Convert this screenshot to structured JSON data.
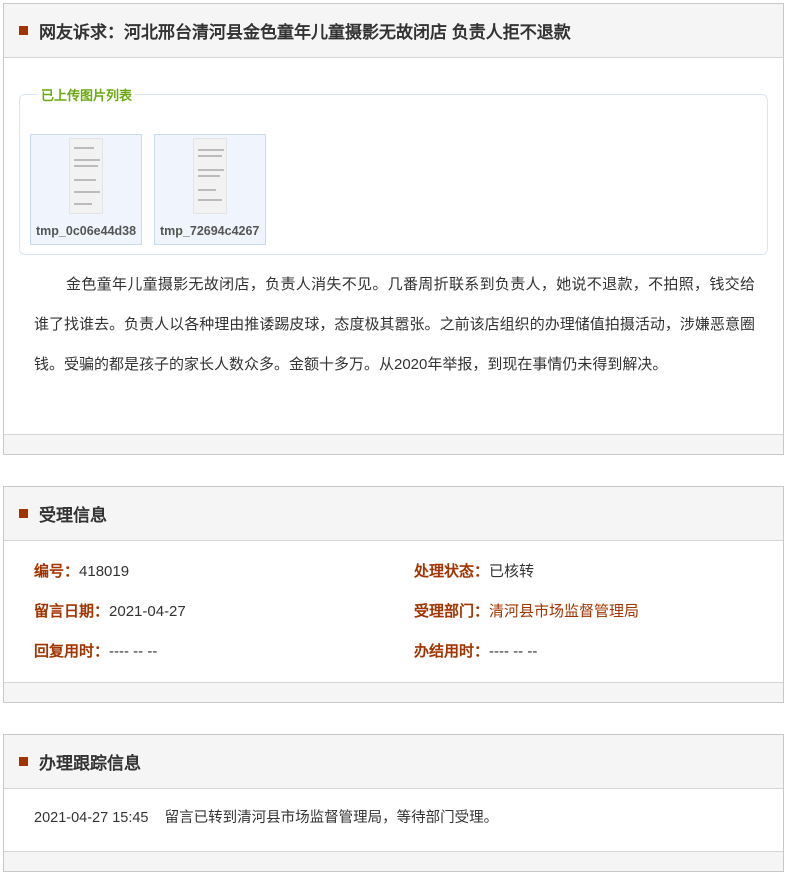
{
  "complaint": {
    "title": "网友诉求：河北邢台清河县金色童年儿童摄影无故闭店 负责人拒不退款",
    "images_legend": "已上传图片列表",
    "images": [
      {
        "name": "tmp_0c06e44d38"
      },
      {
        "name": "tmp_72694c4267"
      }
    ],
    "body": "金色童年儿童摄影无故闭店，负责人消失不见。几番周折联系到负责人，她说不退款，不拍照，钱交给谁了找谁去。负责人以各种理由推诿踢皮球，态度极其嚣张。之前该店组织的办理储值拍摄活动，涉嫌恶意圈钱。受骗的都是孩子的家长人数众多。金额十多万。从2020年举报，到现在事情仍未得到解决。"
  },
  "acceptance": {
    "title": "受理信息",
    "fields": [
      {
        "label": "编号：",
        "value": "418019"
      },
      {
        "label": "处理状态：",
        "value": "已核转"
      },
      {
        "label": "留言日期：",
        "value": "2021-04-27"
      },
      {
        "label": "受理部门：",
        "value": "清河县市场监督管理局"
      },
      {
        "label": "回复用时：",
        "value": "---- -- --"
      },
      {
        "label": "办结用时：",
        "value": "---- -- --"
      }
    ]
  },
  "tracking": {
    "title": "办理跟踪信息",
    "entries": [
      {
        "time": "2021-04-27 15:45",
        "text": "留言已转到清河县市场监督管理局，等待部门受理。"
      }
    ]
  },
  "colors": {
    "accent": "#a23400",
    "legend": "#6aaa10"
  }
}
